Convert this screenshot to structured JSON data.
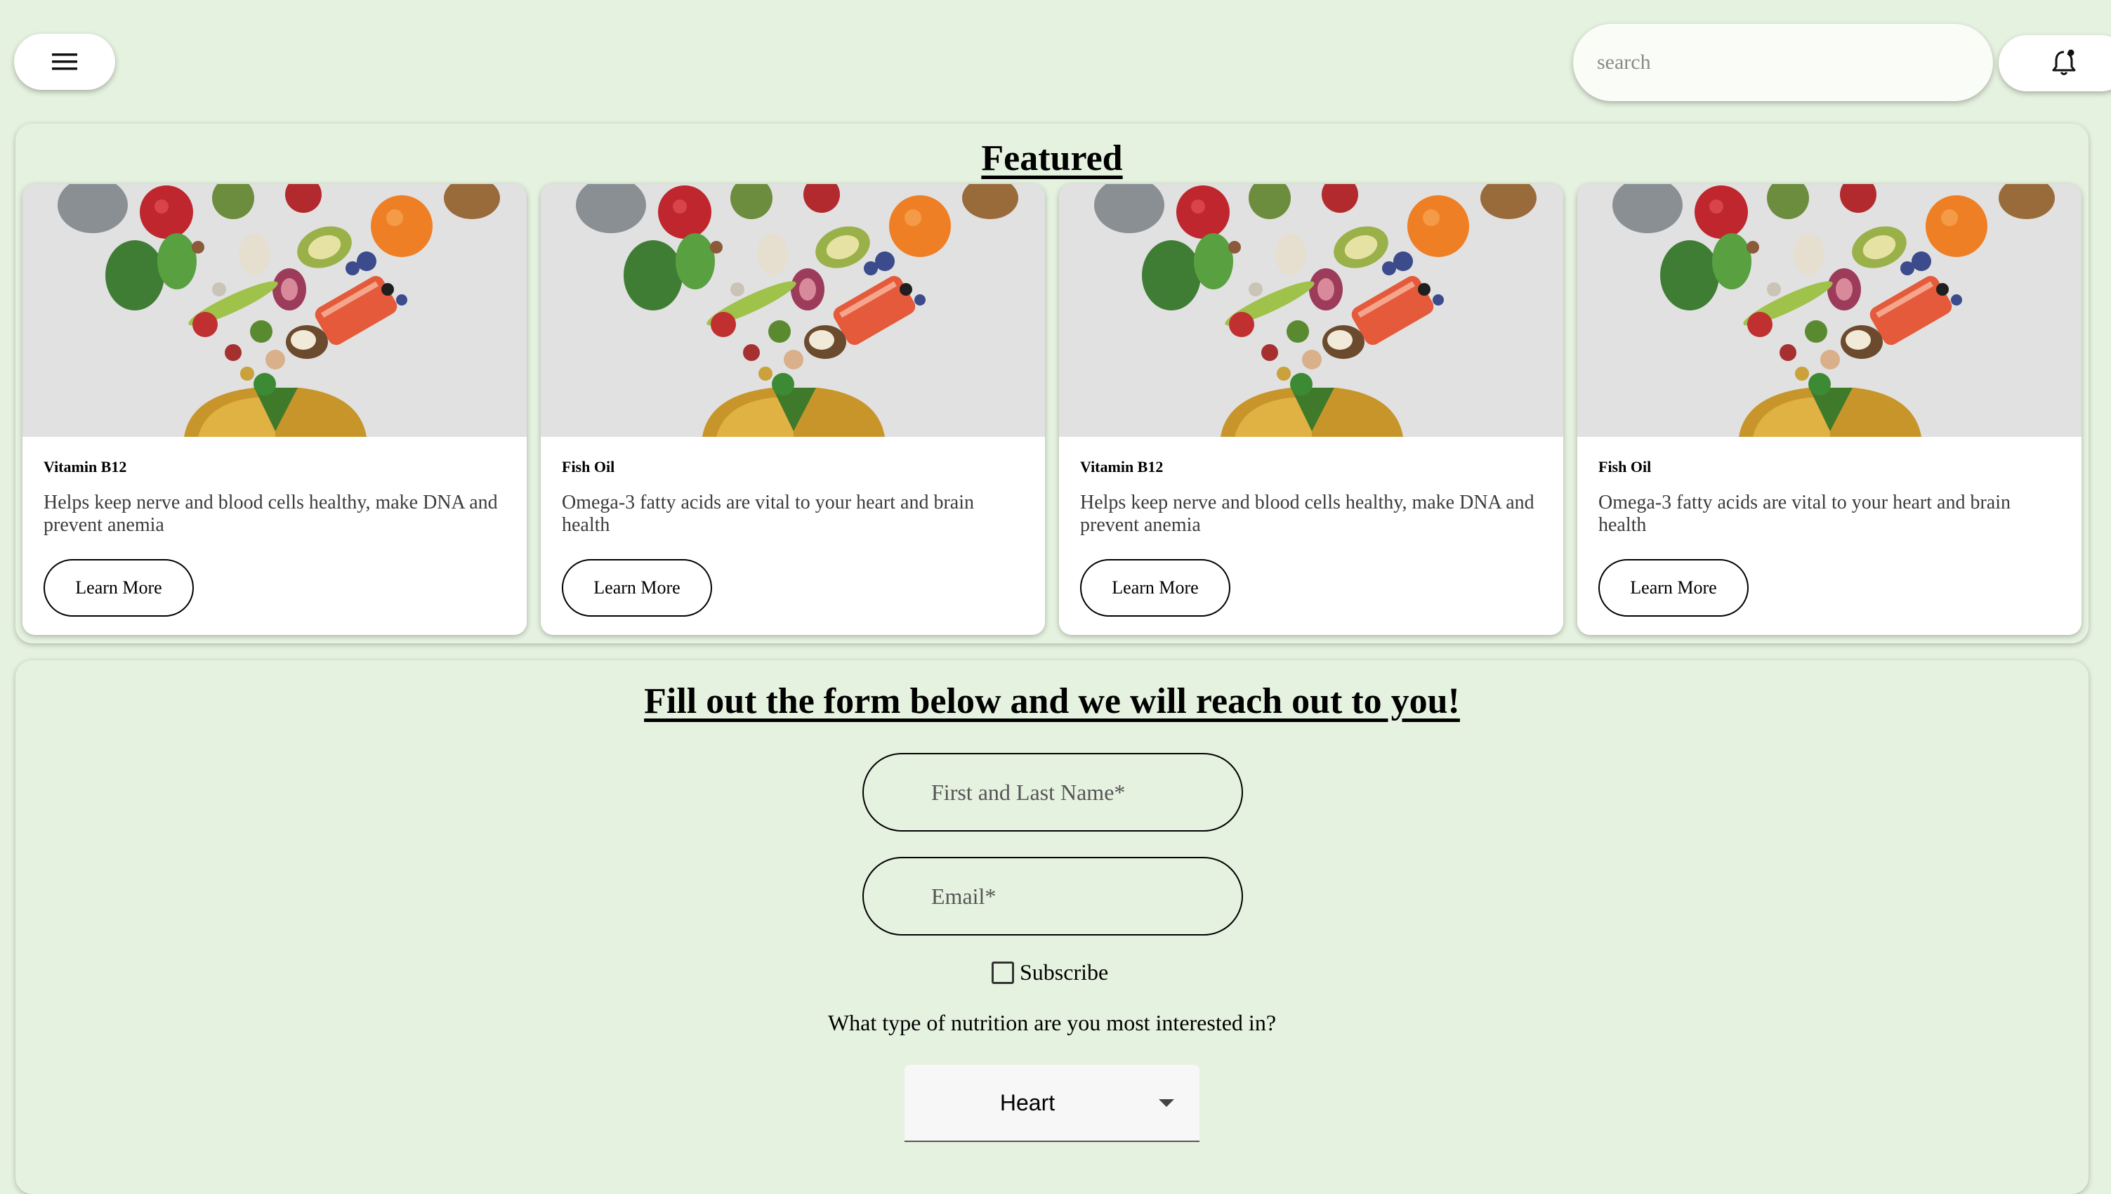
{
  "header": {
    "menu_icon": "hamburger-menu-icon",
    "search_placeholder": "search",
    "search_icon": "none",
    "notification_icon": "bell-notification-icon"
  },
  "featured": {
    "title": "Featured",
    "cards": [
      {
        "title": "Vitamin B12",
        "description": "Helps keep nerve and blood cells healthy, make DNA and prevent anemia",
        "button_label": "Learn More",
        "image": "fruits-vegetables-pouring-into-capsule-image"
      },
      {
        "title": "Fish Oil",
        "description": "Omega-3 fatty acids are vital to your heart and brain health",
        "button_label": "Learn More",
        "image": "fruits-vegetables-pouring-into-capsule-image"
      },
      {
        "title": "Vitamin B12",
        "description": "Helps keep nerve and blood cells healthy, make DNA and prevent anemia",
        "button_label": "Learn More",
        "image": "fruits-vegetables-pouring-into-capsule-image"
      },
      {
        "title": "Fish Oil",
        "description": "Omega-3 fatty acids are vital to your heart and brain health",
        "button_label": "Learn More",
        "image": "fruits-vegetables-pouring-into-capsule-image"
      }
    ]
  },
  "form": {
    "title": "Fill out the form below and we will reach out to you!",
    "name_placeholder": "First and Last Name*",
    "email_placeholder": "Email*",
    "subscribe_label": "Subscribe",
    "subscribe_checked": false,
    "question": "What type of nutrition are you most interested in?",
    "select_value": "Heart"
  },
  "colors": {
    "page_background": "#e6f2e0",
    "card_background": "#ffffff",
    "accent_text": "#000000"
  }
}
